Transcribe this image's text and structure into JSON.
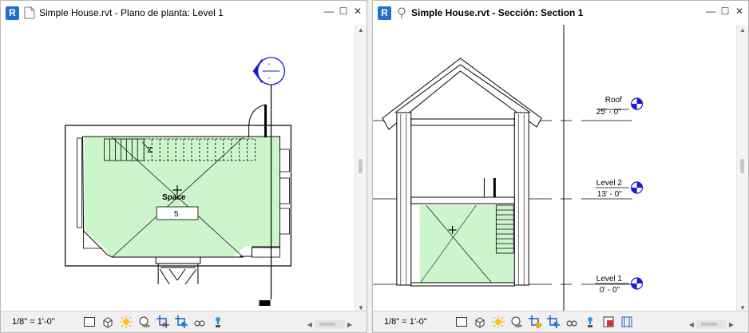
{
  "left_window": {
    "app_logo": "R",
    "title": "Simple House.rvt - Plano de planta: Level 1",
    "room_name": "Space",
    "room_number": "5",
    "stair_label": "Z",
    "scale": "1/8\" = 1'-0\""
  },
  "right_window": {
    "app_logo": "R",
    "title": "Simple House.rvt - Sección: Section 1",
    "scale": "1/8\" = 1'-0\"",
    "levels": [
      {
        "name": "Roof",
        "elevation": "25' - 0\""
      },
      {
        "name": "Level 2",
        "elevation": "13' - 0\""
      },
      {
        "name": "Level 1",
        "elevation": "0' - 0\""
      }
    ]
  },
  "window_buttons": {
    "minimize": "—",
    "maximize": "☐",
    "close": "✕"
  },
  "colors": {
    "room_fill": "#ccf5cc",
    "section_blue": "#1a1ad6",
    "revit_logo": "#1f6fd1"
  },
  "status_tools": [
    "detail-level",
    "visual-style",
    "sun-path",
    "shadows",
    "crop-view",
    "hide-crop",
    "temporary-hide",
    "reveal-hidden",
    "worksharing",
    "highlight",
    "lock-3d",
    "design-options"
  ]
}
